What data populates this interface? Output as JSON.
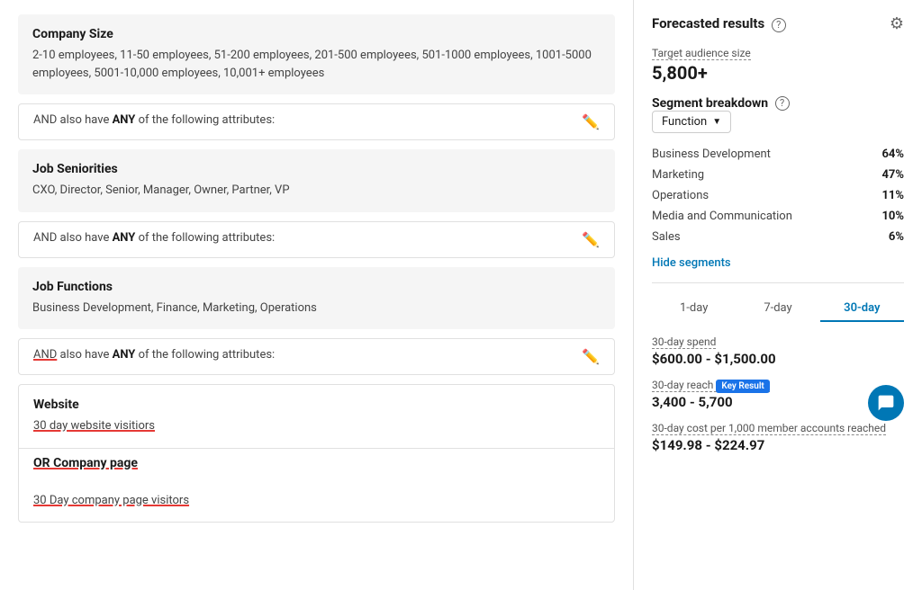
{
  "left": {
    "section1": {
      "title": "Company Size",
      "values": "2-10 employees, 11-50 employees, 51-200 employees, 201-500 employees, 501-1000 employees, 1001-5000 employees, 5001-10,000 employees, 10,001+ employees"
    },
    "connector1": {
      "text_prefix": "AND also have ",
      "text_bold": "ANY",
      "text_suffix": " of the following attributes:"
    },
    "section2": {
      "title": "Job Seniorities",
      "values": "CXO, Director, Senior, Manager, Owner, Partner, VP"
    },
    "connector2": {
      "text_prefix": "AND also have ",
      "text_bold": "ANY",
      "text_suffix": " of the following attributes:"
    },
    "section3": {
      "title": "Job Functions",
      "values": "Business Development, Finance, Marketing, Operations"
    },
    "connector3": {
      "text_prefix": "AND also have ",
      "text_bold": "ANY",
      "text_suffix": " of the following attributes:"
    },
    "section4a": {
      "title": "Website",
      "values": "30 day website visitiors"
    },
    "or_connector": {
      "text": "OR Company page"
    },
    "section4b": {
      "values": "30 Day company page visitors"
    }
  },
  "right": {
    "header": {
      "title": "Forecasted results",
      "help_label": "?",
      "gear_label": "⚙"
    },
    "audience": {
      "label": "Target audience size",
      "value": "5,800+"
    },
    "segment_breakdown": {
      "title": "Segment breakdown",
      "help_label": "?",
      "dropdown_label": "Function",
      "segments": [
        {
          "name": "Business Development",
          "pct": "64%"
        },
        {
          "name": "Marketing",
          "pct": "47%"
        },
        {
          "name": "Operations",
          "pct": "11%"
        },
        {
          "name": "Media and Communication",
          "pct": "10%"
        },
        {
          "name": "Sales",
          "pct": "6%"
        }
      ],
      "hide_segments_label": "Hide segments"
    },
    "tabs": [
      {
        "label": "1-day",
        "active": false
      },
      {
        "label": "7-day",
        "active": false
      },
      {
        "label": "30-day",
        "active": true
      }
    ],
    "metrics": {
      "spend": {
        "label": "30-day spend",
        "value": "$600.00 - $1,500.00"
      },
      "reach": {
        "label": "30-day reach",
        "badge": "Key Result",
        "value": "3,400 - 5,700"
      },
      "cost": {
        "label": "30-day cost per 1,000 member accounts reached",
        "value": "$149.98 - $224.97"
      }
    },
    "chat_icon": "💬"
  }
}
